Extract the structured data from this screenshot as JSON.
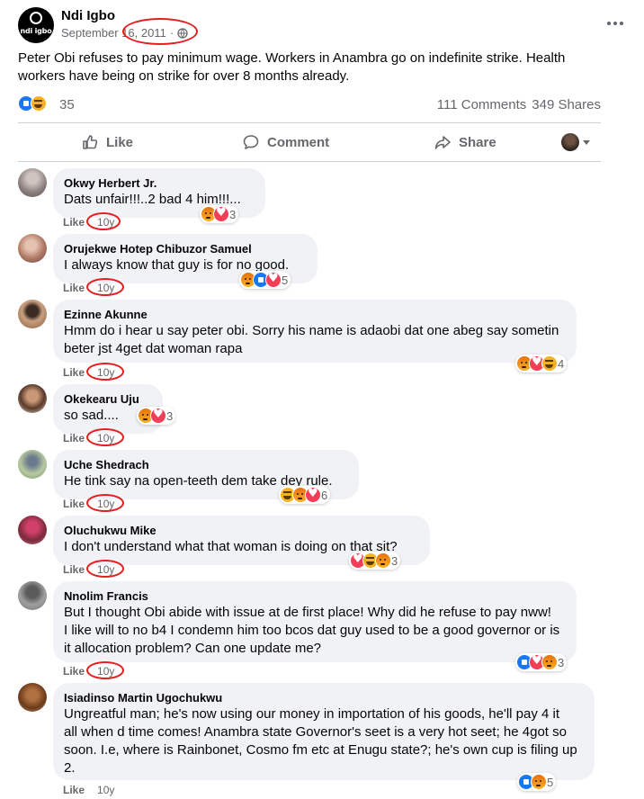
{
  "post": {
    "page_name": "Ndi Igbo",
    "logo_text": "ndi igbo",
    "date": "September 16, 2011",
    "separator": "·",
    "audience_icon": "globe-icon",
    "text": "Peter Obi refuses to pay minimum wage. Workers in Anambra go on indefinite strike.  Health workers have  being on strike for over 8 months already.",
    "reactions": [
      "like",
      "haha"
    ],
    "reaction_count": "35",
    "comments_count": "111 Comments",
    "shares_count": "349 Shares"
  },
  "actions": {
    "like": "Like",
    "comment": "Comment",
    "share": "Share"
  },
  "colors": {
    "annotation_red": "#e41e1e",
    "like_blue": "#1877f2",
    "bubble_grey": "#f0f2f5",
    "meta_grey": "#65676b"
  },
  "comments": [
    {
      "name": "Okwy Herbert Jr.",
      "lines": [
        "Dats unfair!!!..2 bad 4 him!!!..."
      ],
      "reactions": [
        "angry",
        "love"
      ],
      "count": "3",
      "like": "Like",
      "age": "10y"
    },
    {
      "name": "Orujekwe Hotep Chibuzor Samuel",
      "lines": [
        "I always know that guy is for no good."
      ],
      "reactions": [
        "angry",
        "like",
        "love"
      ],
      "count": "5",
      "like": "Like",
      "age": "10y"
    },
    {
      "name": "Ezinne Akunne",
      "lines": [
        "Hmm do i hear u say peter obi. Sorry his name is adaobi dat one abeg say sometin",
        "beter jst 4get dat woman rapa"
      ],
      "reactions": [
        "angry",
        "love",
        "haha"
      ],
      "count": "4",
      "like": "Like",
      "age": "10y"
    },
    {
      "name": "Okekearu Uju",
      "lines": [
        "so sad...."
      ],
      "reactions": [
        "angry",
        "love"
      ],
      "count": "3",
      "like": "Like",
      "age": "10y"
    },
    {
      "name": "Uche Shedrach",
      "lines": [
        "He tink say na open-teeth dem take dey rule."
      ],
      "reactions": [
        "haha",
        "angry",
        "love"
      ],
      "count": "6",
      "like": "Like",
      "age": "10y"
    },
    {
      "name": "Oluchukwu Mike",
      "lines": [
        "I don't understand what that woman is doing on that sit?"
      ],
      "reactions": [
        "love",
        "haha",
        "angry"
      ],
      "count": "3",
      "like": "Like",
      "age": "10y"
    },
    {
      "name": "Nnolim Francis",
      "lines": [
        "But I thought Obi abide with issue at de first place! Why did he refuse to pay nww!",
        "I like will to no b4 I condemn him too bcos dat guy used to be a good governor or is",
        "it allocation problem? Can one update me?"
      ],
      "reactions": [
        "like",
        "love",
        "angry"
      ],
      "count": "3",
      "like": "Like",
      "age": "10y"
    },
    {
      "name": "Isiadinso Martin Ugochukwu",
      "lines": [
        "Ungreatful man; he's now using our money in importation of his goods, he'll pay 4 it",
        "all when d time comes! Anambra state Governor's seet is a very hot seet; he 4got so",
        "soon. I.e, where is Rainbonet, Cosmo fm etc at Enugu state?; he's own cup is filing up",
        "2."
      ],
      "reactions": [
        "like",
        "angry"
      ],
      "count": "5",
      "like": "Like",
      "age": "10y"
    }
  ]
}
